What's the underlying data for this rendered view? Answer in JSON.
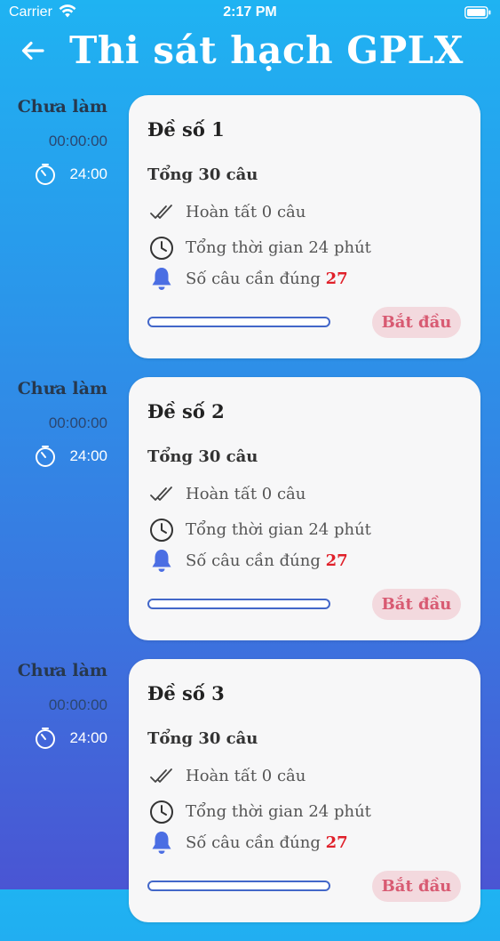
{
  "status_bar": {
    "carrier": "Carrier",
    "time": "2:17 PM"
  },
  "header": {
    "title": "Thi sát hạch GPLX",
    "back_icon": "arrow-left-icon"
  },
  "colors": {
    "accent": "#4367c9",
    "start_text": "#d85a72",
    "start_bg": "#f3d9de",
    "highlight": "#e0202a"
  },
  "exams": [
    {
      "status": "Chưa làm",
      "elapsed": "00:00:00",
      "duration": "24:00",
      "title": "Đề số 1",
      "total": "Tổng 30 câu",
      "completed": "Hoàn tất 0 câu",
      "time_total": "Tổng thời gian 24 phút",
      "required_label": "Số câu cần đúng",
      "required_count": "27",
      "progress": 0,
      "start_label": "Bắt đầu"
    },
    {
      "status": "Chưa làm",
      "elapsed": "00:00:00",
      "duration": "24:00",
      "title": "Đề số 2",
      "total": "Tổng 30 câu",
      "completed": "Hoàn tất 0 câu",
      "time_total": "Tổng thời gian 24 phút",
      "required_label": "Số câu cần đúng",
      "required_count": "27",
      "progress": 0,
      "start_label": "Bắt đầu"
    },
    {
      "status": "Chưa làm",
      "elapsed": "00:00:00",
      "duration": "24:00",
      "title": "Đề số 3",
      "total": "Tổng 30 câu",
      "completed": "Hoàn tất 0 câu",
      "time_total": "Tổng thời gian 24 phút",
      "required_label": "Số câu cần đúng",
      "required_count": "27",
      "progress": 0,
      "start_label": "Bắt đầu"
    }
  ]
}
